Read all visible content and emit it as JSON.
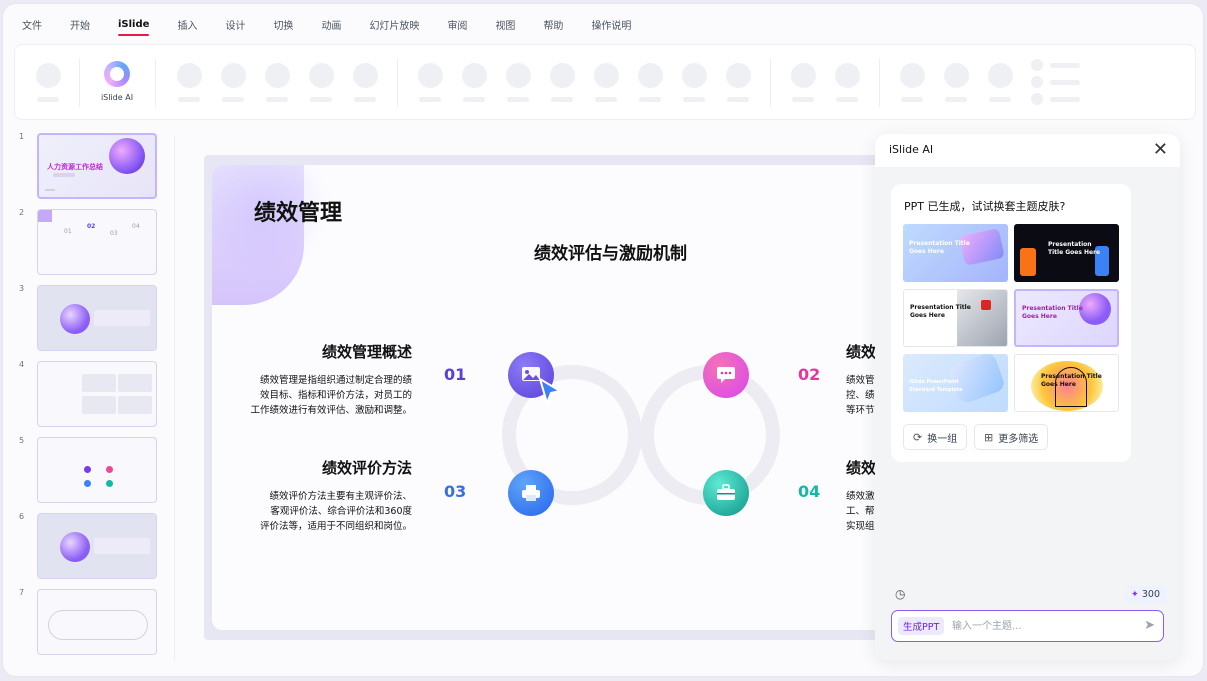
{
  "menu": [
    "文件",
    "开始",
    "iSlide",
    "插入",
    "设计",
    "切换",
    "动画",
    "幻灯片放映",
    "审阅",
    "视图",
    "帮助",
    "操作说明"
  ],
  "ribbon": {
    "islide_label": "iSlide AI"
  },
  "thumbnails": {
    "numbers": [
      "1",
      "2",
      "3",
      "4",
      "5",
      "6",
      "7"
    ],
    "t1_title": "人力资源工作总结",
    "t2_items": [
      "01",
      "02",
      "03",
      "04"
    ]
  },
  "slide": {
    "title": "绩效管理",
    "subtitle": "绩效评估与激励机制",
    "sections": [
      {
        "num": "01",
        "heading": "绩效管理概述",
        "lines": [
          "绩效管理是指组织通过制定合理的绩",
          "效目标、指标和评价方法，对员工的",
          "工作绩效进行有效评估、激励和调整。"
        ]
      },
      {
        "num": "02",
        "heading": "绩效",
        "lines": [
          "绩效管",
          "控、绩",
          "等环节"
        ]
      },
      {
        "num": "03",
        "heading": "绩效评价方法",
        "lines": [
          "绩效评价方法主要有主观评价法、",
          "客观评价法、综合评价法和360度",
          "评价法等，适用于不同组织和岗位。"
        ]
      },
      {
        "num": "04",
        "heading": "绩效",
        "lines": [
          "绩效激",
          "工、帮",
          "实现组"
        ]
      }
    ],
    "colors": {
      "c01": "#5b3fd8",
      "c02": "#e0389b",
      "c03": "#3b6fe0",
      "c04": "#14b8a6"
    }
  },
  "ai_panel": {
    "title": "iSlide AI",
    "prompt": "PPT 已生成，试试换套主题皮肤?",
    "themes": [
      {
        "text": [
          "Presentation Title",
          "Goes Here"
        ]
      },
      {
        "text": [
          "Presentation",
          "Title Goes Here"
        ]
      },
      {
        "text": [
          "Presentation Title",
          "Goes Here"
        ]
      },
      {
        "text": [
          "Presentation Title",
          "Goes Here"
        ]
      },
      {
        "text": [
          "iSlide PowerPoint",
          "Standard Template"
        ]
      },
      {
        "text": [
          "Presentation Title",
          "Goes Here"
        ]
      }
    ],
    "btn_swap": "换一组",
    "btn_filter": "更多筛选",
    "credits": "300",
    "mode": "生成PPT",
    "input_placeholder": "输入一个主题..."
  }
}
